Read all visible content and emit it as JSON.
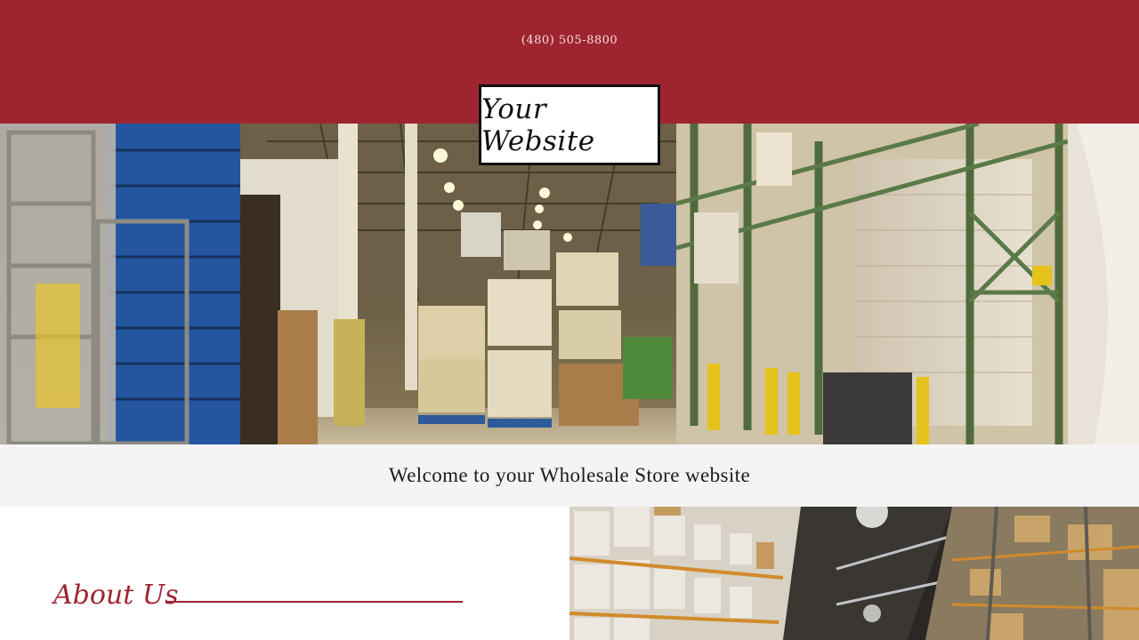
{
  "header": {
    "phone": "(480) 505-8800",
    "logo_text": "Your Website",
    "background_color": "#9e2430"
  },
  "hero": {
    "image": "warehouse-interior-photo"
  },
  "welcome": {
    "text": "Welcome to your Wholesale Store website"
  },
  "about": {
    "heading": "About Us",
    "accent_color": "#9e2430",
    "image": "warehouse-shelving-photo"
  }
}
